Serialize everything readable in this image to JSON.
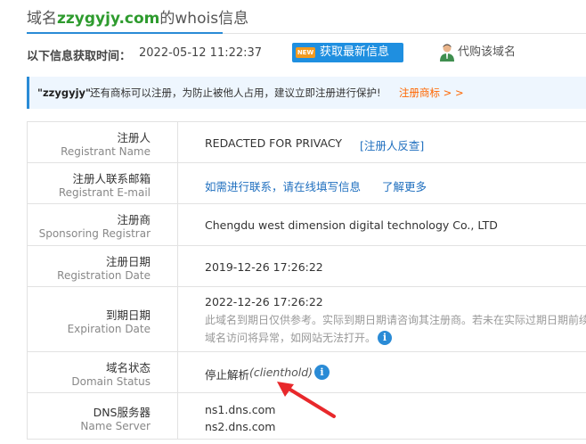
{
  "header": {
    "title_prefix": "域名",
    "title_domain": "zzygyjy.com",
    "title_suffix": "的whois信息"
  },
  "info": {
    "time_label": "以下信息获取时间：",
    "time_value": "2022-05-12 11:22:37",
    "new_badge": "NEW",
    "refresh_label": "获取最新信息",
    "buy_label": "代购该域名"
  },
  "notice": {
    "domain": "\"zzygyjy\"",
    "text": "还有商标可以注册，为防止被他人占用，建议立即注册进行保护!",
    "link": "注册商标 > >"
  },
  "rows": {
    "registrant": {
      "label_zh": "注册人",
      "label_en": "Registrant Name",
      "value": "REDACTED FOR PRIVACY",
      "link": "[注册人反查]"
    },
    "email": {
      "label_zh": "注册人联系邮箱",
      "label_en": "Registrant E-mail",
      "value_link": "如需进行联系，请在线填写信息",
      "more_link": "了解更多"
    },
    "registrar": {
      "label_zh": "注册商",
      "label_en": "Sponsoring Registrar",
      "value": "Chengdu west dimension digital technology Co., LTD"
    },
    "created": {
      "label_zh": "注册日期",
      "label_en": "Registration Date",
      "value": "2019-12-26 17:26:22"
    },
    "expiry": {
      "label_zh": "到期日期",
      "label_en": "Expiration Date",
      "value": "2022-12-26 17:26:22",
      "note_line1": "此域名到期日仅供参考。实际到期日期请咨询其注册商。若未在实际过期日期前续",
      "note_line2": "域名访问将异常，如网站无法打开。"
    },
    "status": {
      "label_zh": "域名状态",
      "label_en": "Domain Status",
      "value": "停止解析",
      "code": "(clienthold)"
    },
    "dns": {
      "label_zh": "DNS服务器",
      "label_en": "Name Server",
      "ns1": "ns1.dns.com",
      "ns2": "ns2.dns.com"
    }
  },
  "icons": {
    "info": "i",
    "info_color": "#2a8bd6",
    "arrow_color": "#e8282b",
    "accent": "#1f8fe0",
    "link_orange": "#ff6600",
    "domain_green": "#2e9b2e"
  }
}
